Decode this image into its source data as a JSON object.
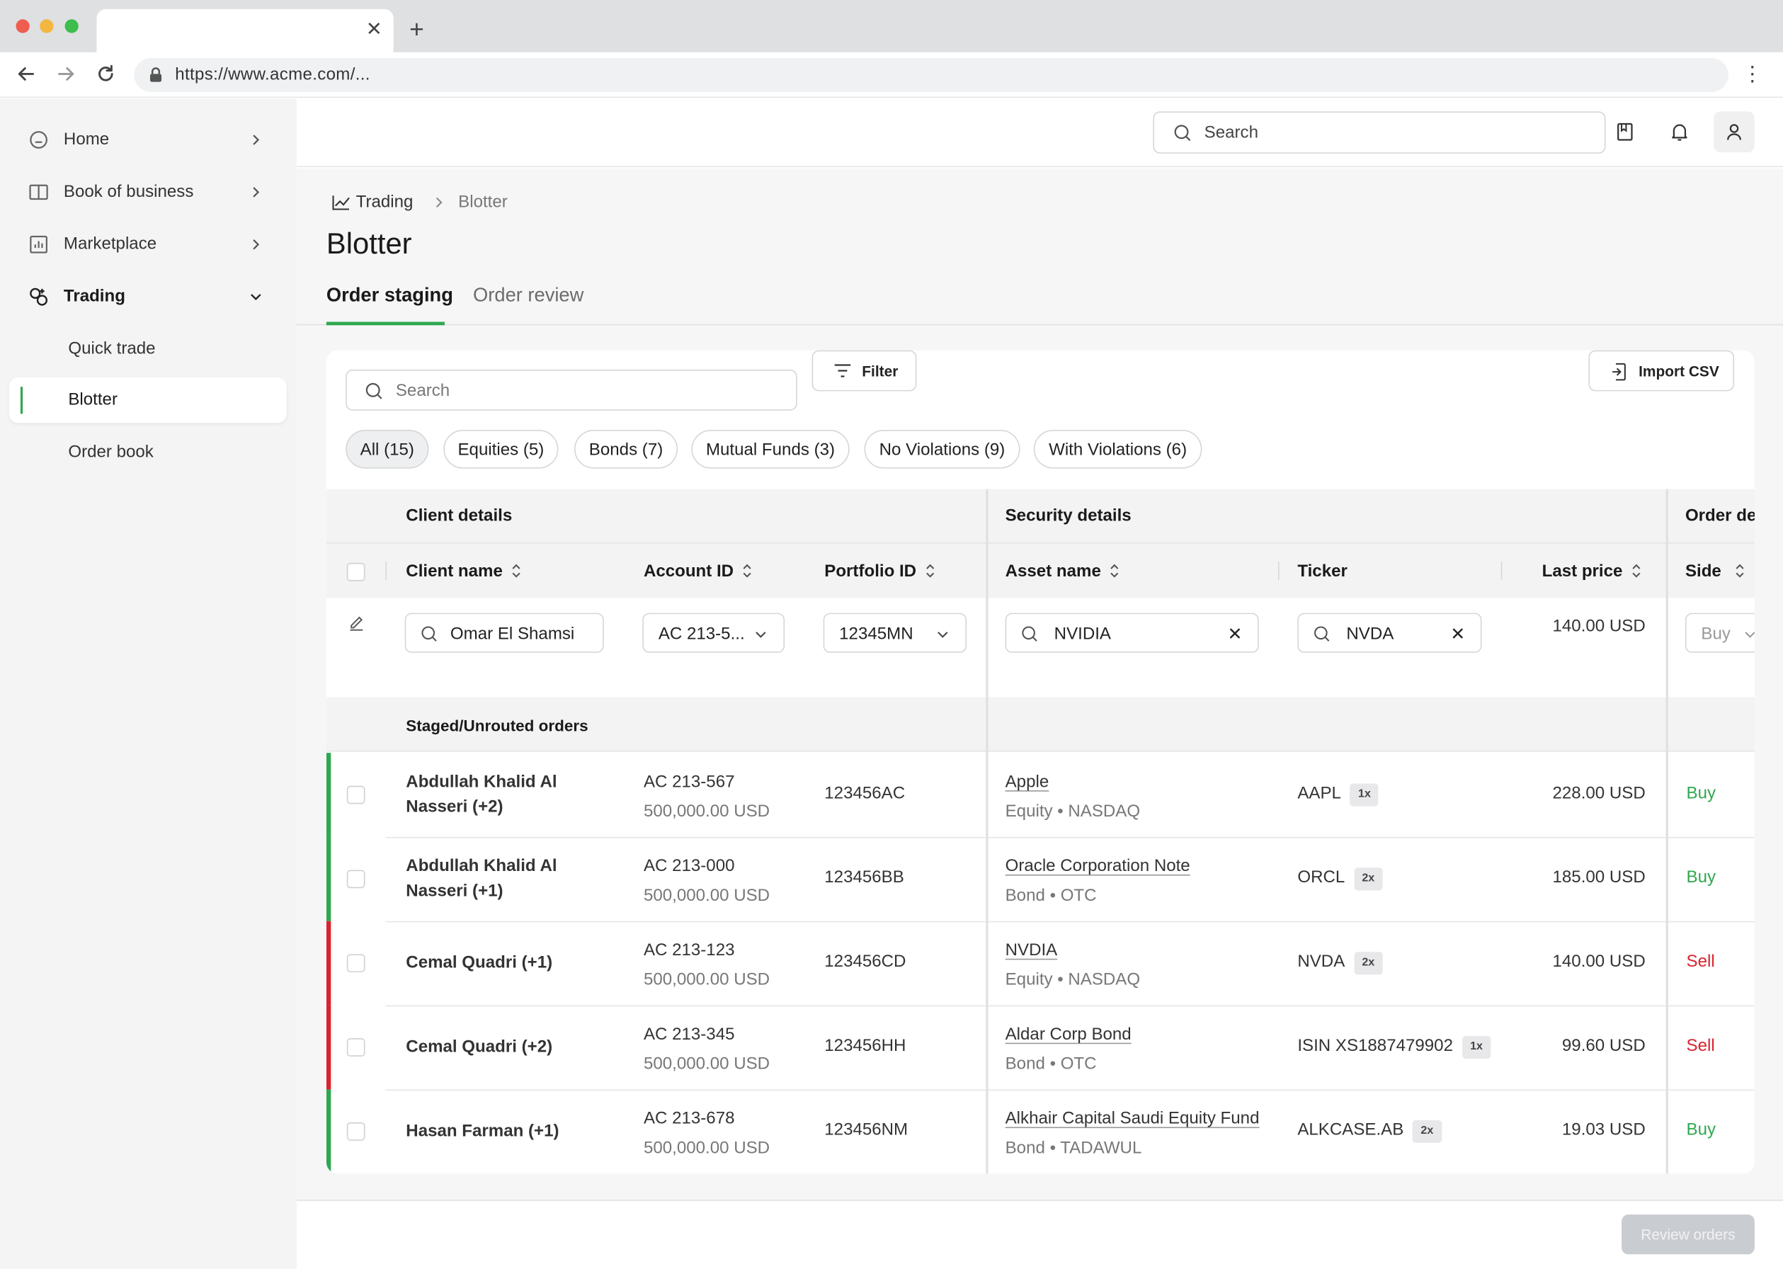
{
  "browser": {
    "url": "https://www.acme.com/...",
    "traffic_light_colors": [
      "#ee5d50",
      "#f3b63f",
      "#3cbd4c"
    ]
  },
  "sidebar": {
    "items": [
      {
        "label": "Home",
        "icon": "home-icon"
      },
      {
        "label": "Book of business",
        "icon": "book-icon"
      },
      {
        "label": "Marketplace",
        "icon": "chart-box-icon"
      },
      {
        "label": "Trading",
        "icon": "trading-icon",
        "expanded": true
      }
    ],
    "sub_items": [
      {
        "label": "Quick trade"
      },
      {
        "label": "Blotter",
        "active": true
      },
      {
        "label": "Order book"
      }
    ]
  },
  "header": {
    "search_placeholder": "Search"
  },
  "breadcrumb": {
    "root": "Trading",
    "current": "Blotter"
  },
  "page": {
    "title": "Blotter",
    "tabs": [
      {
        "label": "Order staging",
        "active": true
      },
      {
        "label": "Order review",
        "active": false
      }
    ]
  },
  "toolbar": {
    "search_placeholder": "Search",
    "filter_label": "Filter",
    "import_label": "Import CSV"
  },
  "chips": [
    {
      "label": "All (15)",
      "active": true
    },
    {
      "label": "Equities (5)"
    },
    {
      "label": "Bonds (7)"
    },
    {
      "label": "Mutual Funds (3)"
    },
    {
      "label": "No Violations (9)"
    },
    {
      "label": "With Violations (6)"
    }
  ],
  "table": {
    "groups": {
      "client": "Client details",
      "security": "Security details",
      "order": "Order det"
    },
    "columns": {
      "client_name": "Client name",
      "account_id": "Account ID",
      "portfolio_id": "Portfolio ID",
      "asset_name": "Asset name",
      "ticker": "Ticker",
      "last_price": "Last price",
      "side": "Side"
    },
    "entry_row": {
      "client": "Omar El Shamsi",
      "account": "AC 213-5...",
      "portfolio": "12345MN",
      "asset": "NVIDIA",
      "ticker": "NVDA",
      "last_price": "140.00 USD",
      "side": "Buy"
    },
    "section_label": "Staged/Unrouted orders",
    "rows": [
      {
        "client": "Abdullah Khalid Al Nasseri (+2)",
        "account": "AC 213-567",
        "account_value": "500,000.00 USD",
        "portfolio": "123456AC",
        "asset": "Apple",
        "asset_meta": "Equity • NASDAQ",
        "ticker": "AAPL",
        "multiplier": "1x",
        "last_price": "228.00 USD",
        "side": "Buy",
        "status_color": "#2fa84f"
      },
      {
        "client": "Abdullah Khalid Al Nasseri (+1)",
        "account": "AC 213-000",
        "account_value": "500,000.00 USD",
        "portfolio": "123456BB",
        "asset": "Oracle Corporation Note",
        "asset_meta": "Bond • OTC",
        "ticker": "ORCL",
        "multiplier": "2x",
        "last_price": "185.00 USD",
        "side": "Buy",
        "status_color": "#2fa84f"
      },
      {
        "client": "Cemal Quadri (+1)",
        "account": "AC 213-123",
        "account_value": "500,000.00 USD",
        "portfolio": "123456CD",
        "asset": "NVDIA",
        "asset_meta": "Equity • NASDAQ",
        "ticker": "NVDA",
        "multiplier": "2x",
        "last_price": "140.00 USD",
        "side": "Sell",
        "status_color": "#d9232e"
      },
      {
        "client": "Cemal Quadri (+2)",
        "account": "AC 213-345",
        "account_value": "500,000.00 USD",
        "portfolio": "123456HH",
        "asset": "Aldar Corp Bond",
        "asset_meta": "Bond • OTC",
        "ticker": "ISIN XS1887479902",
        "multiplier": "1x",
        "last_price": "99.60 USD",
        "side": "Sell",
        "status_color": "#d9232e"
      },
      {
        "client": "Hasan Farman (+1)",
        "account": "AC 213-678",
        "account_value": "500,000.00 USD",
        "portfolio": "123456NM",
        "asset": "Alkhair Capital Saudi Equity Fund",
        "asset_meta": "Bond • TADAWUL",
        "ticker": "ALKCASE.AB",
        "multiplier": "2x",
        "last_price": "19.03 USD",
        "side": "Buy",
        "status_color": "#2fa84f"
      }
    ]
  },
  "footer": {
    "review_label": "Review orders"
  },
  "colors": {
    "accent": "#2fa84f",
    "buy": "#2fa84f",
    "sell": "#d9232e"
  }
}
